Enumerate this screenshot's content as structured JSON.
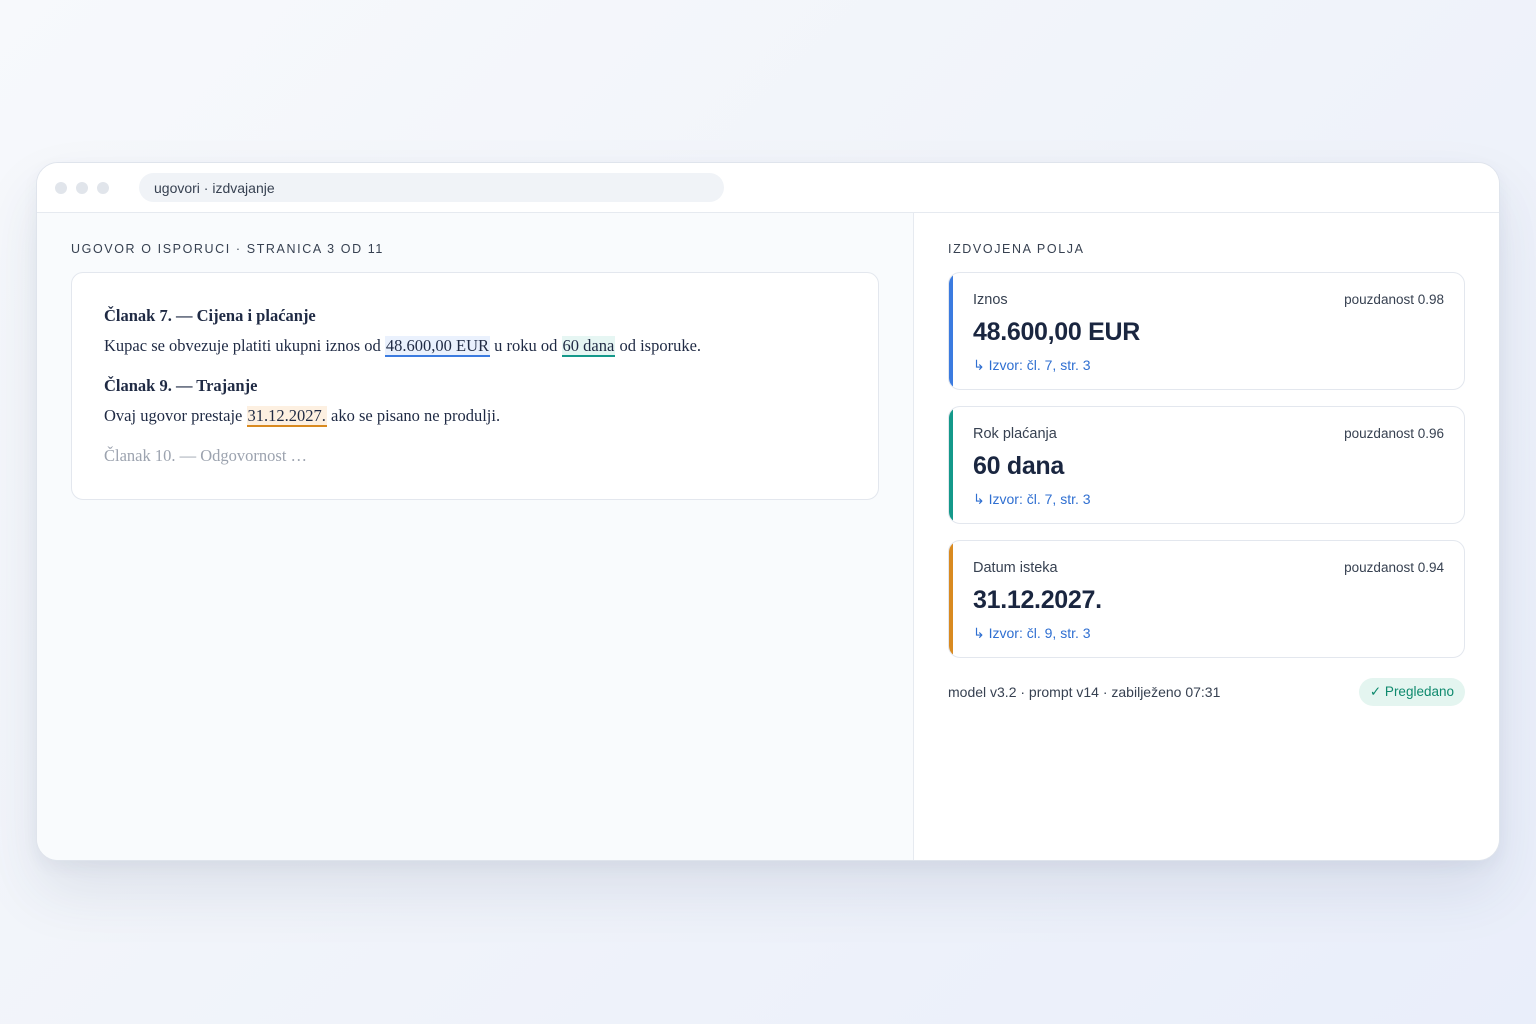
{
  "window": {
    "address": "ugovori · izdvajanje"
  },
  "document": {
    "header": "UGOVOR O ISPORUCI · STRANICA 3 OD 11",
    "article7": {
      "heading": "Članak 7. — Cijena i plaćanje",
      "text_before": "Kupac se obvezuje platiti ukupni iznos od",
      "amount": "48.600,00 EUR",
      "text_middle": "u roku od",
      "term": "60 dana",
      "text_after": "od isporuke."
    },
    "article9": {
      "heading": "Članak 9. — Trajanje",
      "text_before": "Ovaj ugovor prestaje",
      "date": "31.12.2027.",
      "text_after": "ako se pisano ne produlji."
    },
    "article10": {
      "heading_muted": "Članak 10. — Odgovornost …"
    }
  },
  "extracted": {
    "header": "IZDVOJENA POLJA",
    "fields": [
      {
        "label": "Iznos",
        "confidence": "pouzdanost 0.98",
        "value": "48.600,00 EUR",
        "source": "↳ Izvor: čl. 7, str. 3",
        "color": "#3b7be0"
      },
      {
        "label": "Rok plaćanja",
        "confidence": "pouzdanost 0.96",
        "value": "60 dana",
        "source": "↳ Izvor: čl. 7, str. 3",
        "color": "#14998a"
      },
      {
        "label": "Datum isteka",
        "confidence": "pouzdanost 0.94",
        "value": "31.12.2027.",
        "source": "↳ Izvor: čl. 9, str. 3",
        "color": "#d98a20"
      }
    ],
    "meta": "model v3.2 · prompt v14 · zabilježeno 07:31",
    "status_badge": "✓ Pregledano"
  }
}
